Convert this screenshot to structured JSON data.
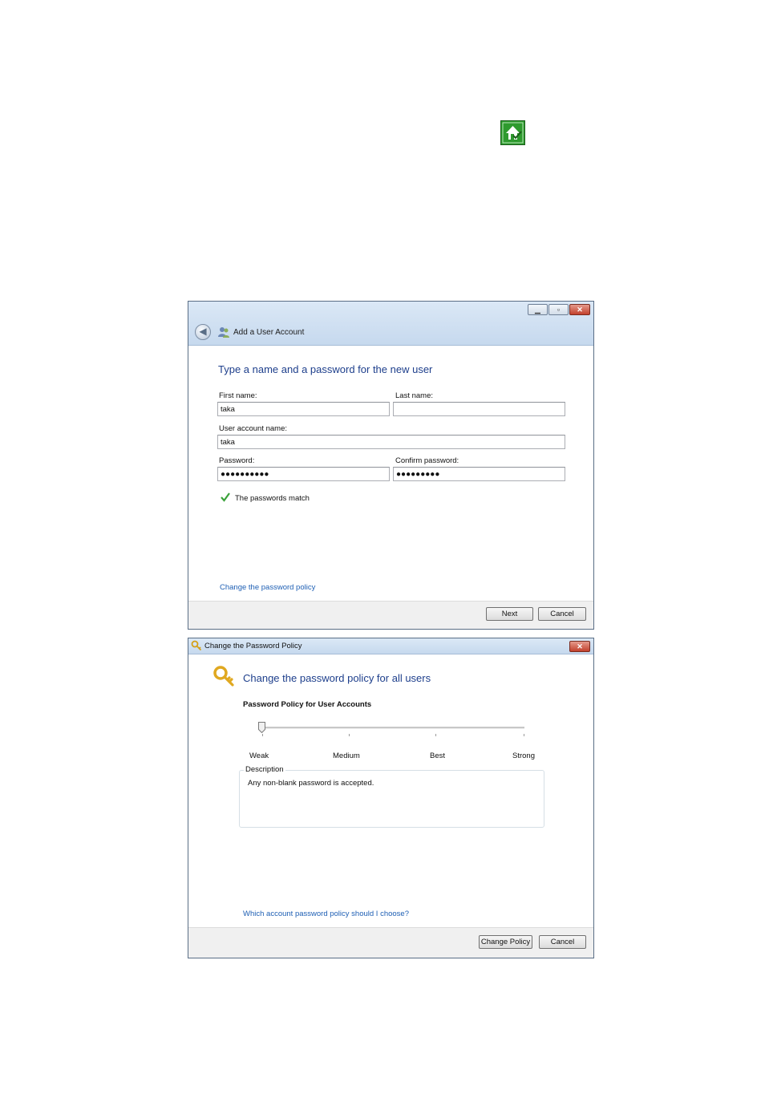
{
  "add_user_window": {
    "title": "Add a User Account",
    "heading": "Type a name and a password for the new user",
    "first_name_label": "First name:",
    "first_name_value": "taka",
    "last_name_label": "Last name:",
    "last_name_value": "",
    "account_name_label": "User account name:",
    "account_name_value": "taka",
    "password_label": "Password:",
    "password_value": "●●●●●●●●●●",
    "confirm_label": "Confirm password:",
    "confirm_value": "●●●●●●●●●",
    "match_text": "The passwords match",
    "policy_link": "Change the password policy",
    "next_button": "Next",
    "cancel_button": "Cancel"
  },
  "policy_window": {
    "title": "Change the Password Policy",
    "heading": "Change the password policy for all users",
    "section_label": "Password Policy for User Accounts",
    "levels": [
      "Weak",
      "Medium",
      "Best",
      "Strong"
    ],
    "selected_level": "Weak",
    "description_title": "Description",
    "description_text": "Any non-blank password is accepted.",
    "help_link": "Which account password policy should I choose?",
    "change_button": "Change Policy",
    "cancel_button": "Cancel"
  },
  "colors": {
    "heading": "#1e3f8c",
    "link": "#1e5fb4",
    "home_icon": "#2e9a2e"
  }
}
